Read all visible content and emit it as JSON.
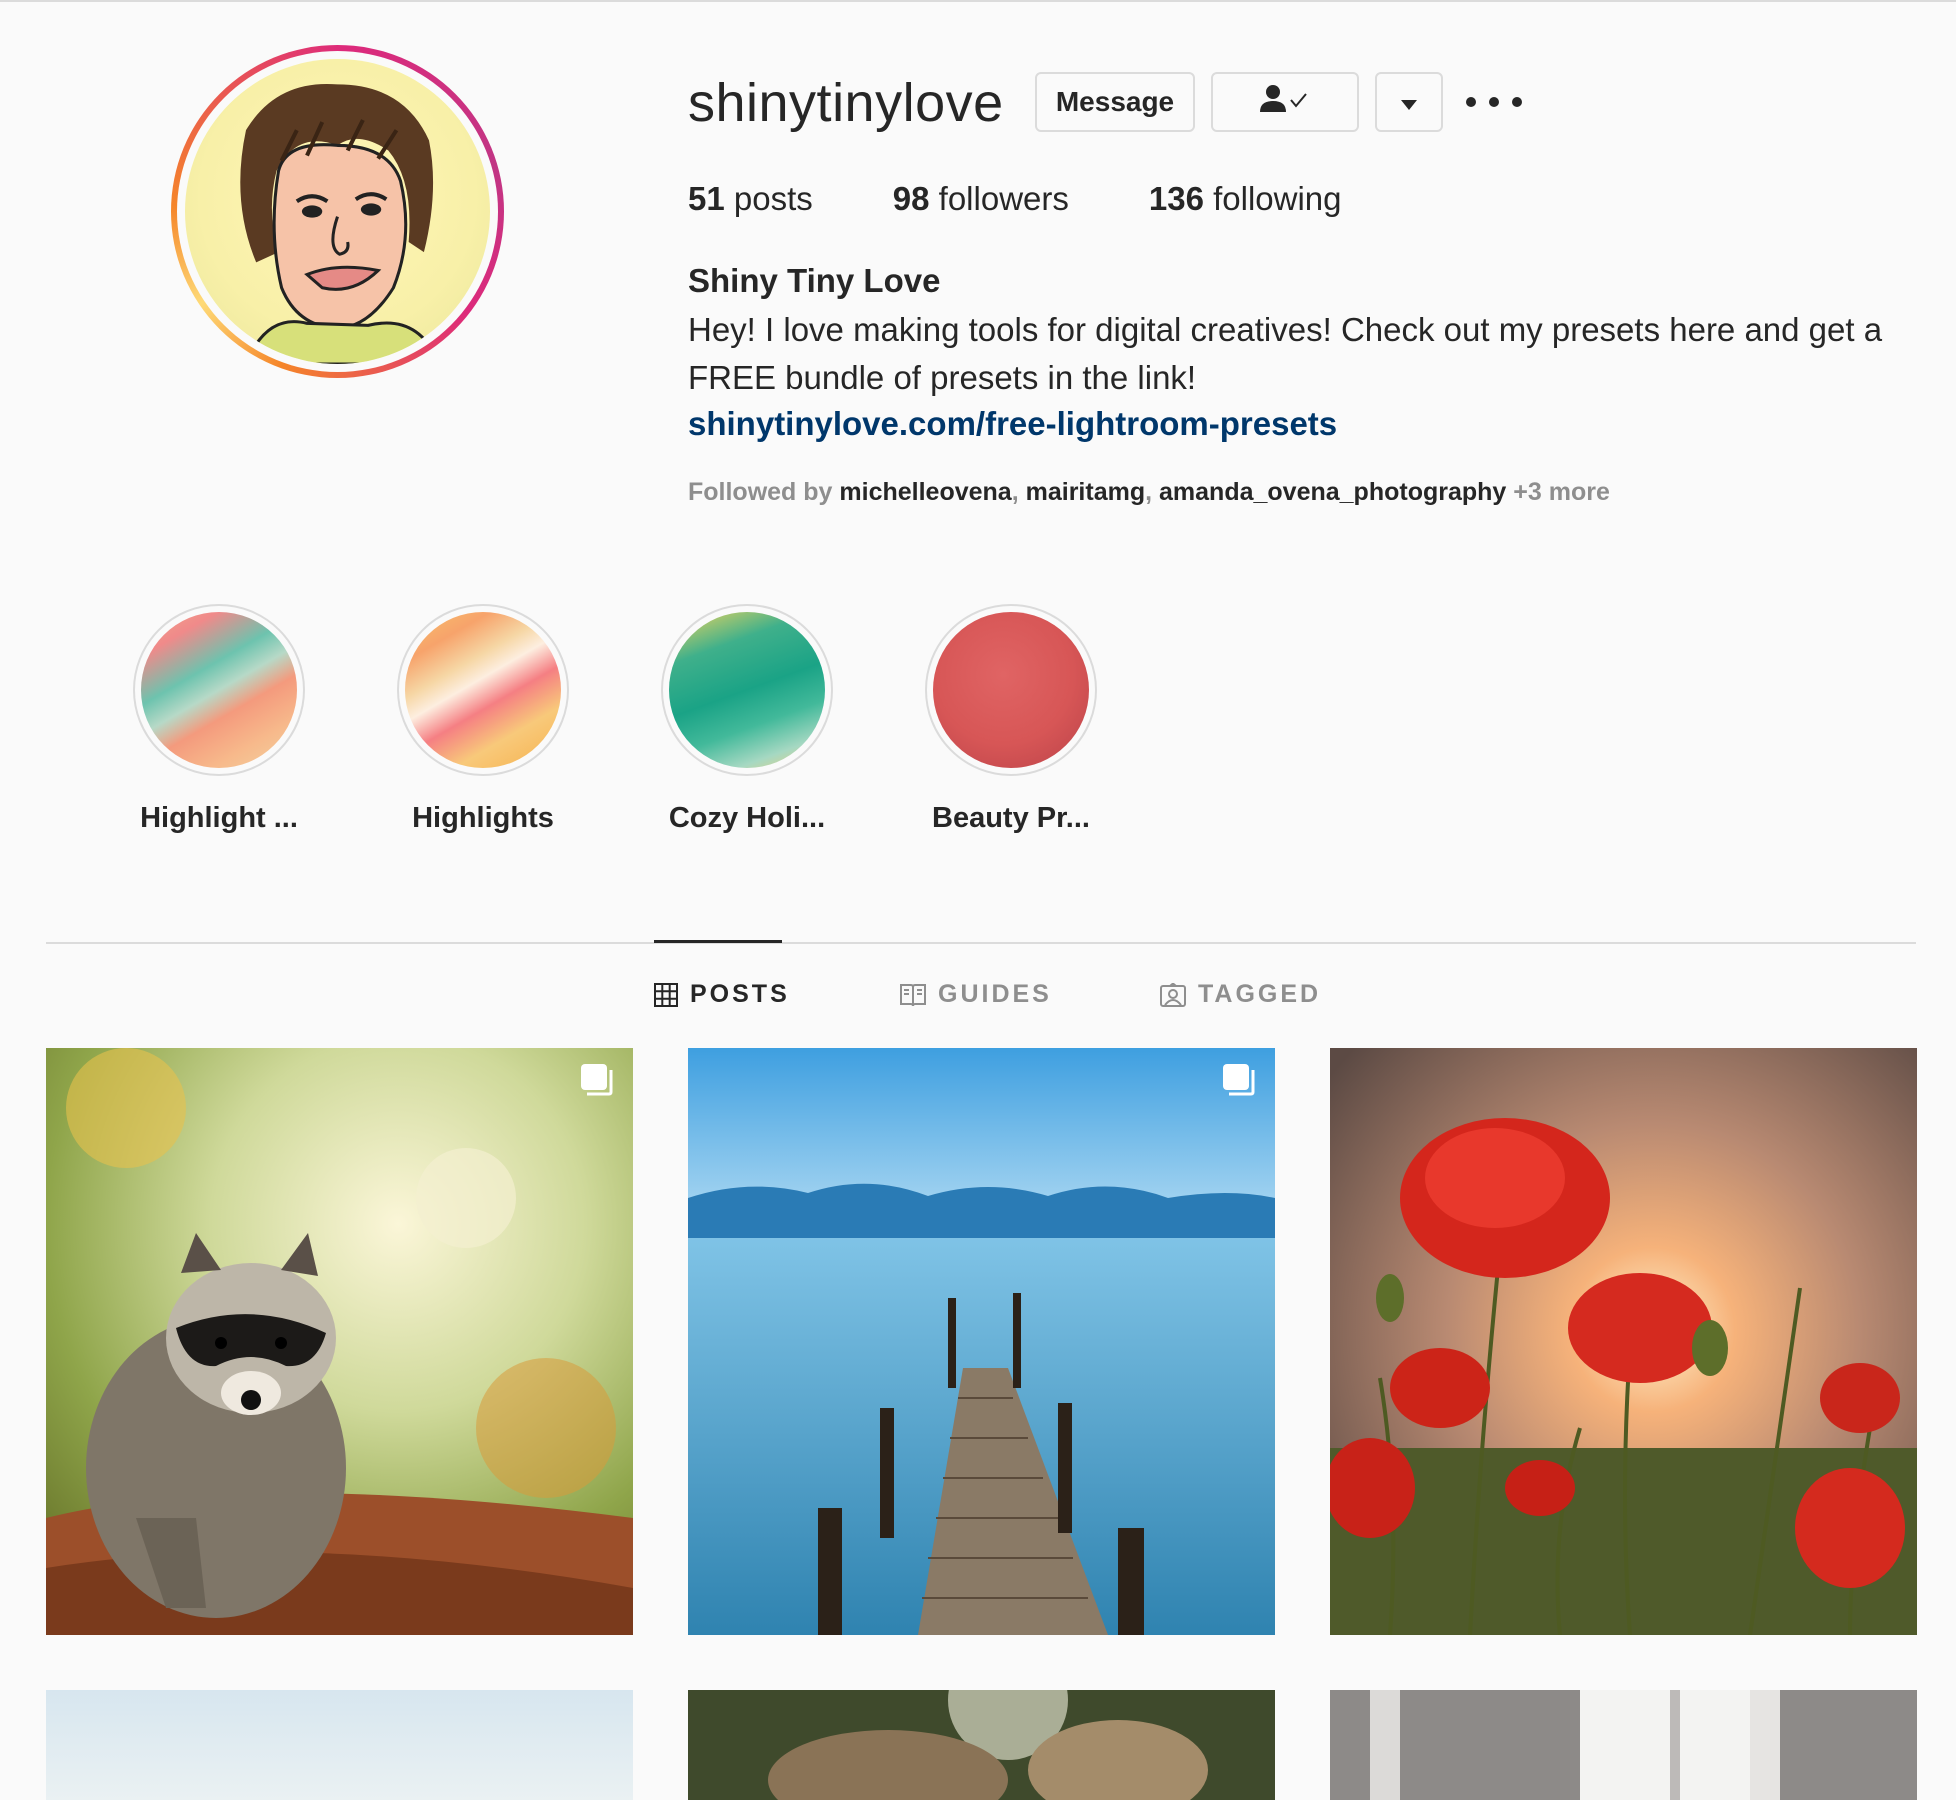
{
  "profile": {
    "username": "shinytinylove",
    "buttons": {
      "message": "Message"
    },
    "stats": [
      {
        "count": "51",
        "label": "posts"
      },
      {
        "count": "98",
        "label": "followers"
      },
      {
        "count": "136",
        "label": "following"
      }
    ],
    "full_name": "Shiny Tiny Love",
    "bio": "Hey! I love making tools for digital creatives! Check out my presets here and get a FREE bundle of presets in the link!",
    "link": "shinytinylove.com/free-lightroom-presets",
    "followed_by": {
      "prefix": "Followed by",
      "users": [
        "michelleovena",
        "mairitamg",
        "amanda_ovena_photography"
      ],
      "more": "+3 more"
    }
  },
  "highlights": [
    {
      "label": "Highlight ..."
    },
    {
      "label": "Highlights"
    },
    {
      "label": "Cozy Holi..."
    },
    {
      "label": "Beauty Pr..."
    }
  ],
  "tabs": [
    {
      "label": "POSTS",
      "icon": "grid-icon",
      "active": true
    },
    {
      "label": "GUIDES",
      "icon": "guides-icon",
      "active": false
    },
    {
      "label": "TAGGED",
      "icon": "tagged-icon",
      "active": false
    }
  ],
  "posts": [
    {
      "subject": "raccoon",
      "multi": true
    },
    {
      "subject": "pier-lake",
      "multi": true
    },
    {
      "subject": "red-poppies",
      "multi": false
    },
    {
      "subject": "sky",
      "multi": false
    },
    {
      "subject": "forest-animal",
      "multi": false
    },
    {
      "subject": "window",
      "multi": false
    }
  ],
  "colors": {
    "background": "#fafafa",
    "text": "#262626",
    "secondary_text": "#8e8e8e",
    "link": "#00376b",
    "border": "#dbdbdb"
  }
}
